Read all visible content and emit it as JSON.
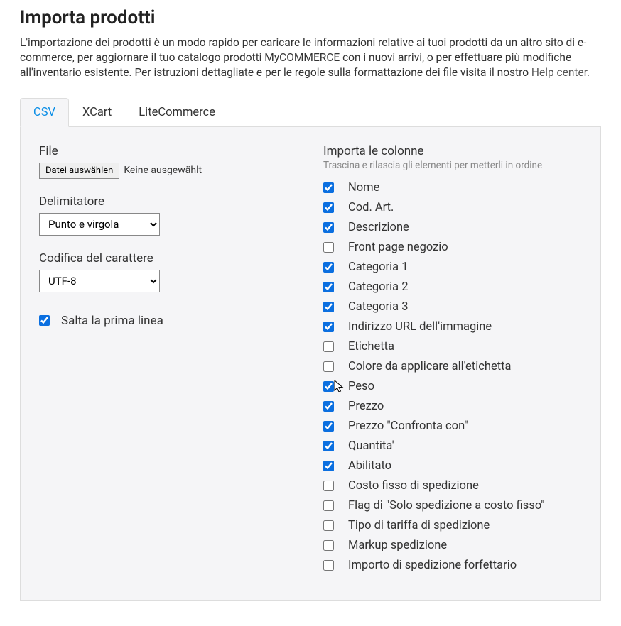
{
  "header": {
    "title": "Importa prodotti",
    "description": "L'importazione dei prodotti è un modo rapido per caricare le informazioni relative ai tuoi prodotti da un altro sito di e-commerce, per aggiornare il tuo catalogo prodotti MyCOMMERCE con i nuovi arrivi, o per effettuare più modifiche all'inventario esistente. Per istruzioni dettagliate e per le regole sulla formattazione dei file visita il nostro ",
    "help_link": "Help center."
  },
  "tabs": {
    "csv": "CSV",
    "xcart": "XCart",
    "litecommerce": "LiteCommerce"
  },
  "left": {
    "file_label": "File",
    "file_button": "Datei auswählen",
    "file_status": "Keine ausgewählt",
    "delimiter_label": "Delimitatore",
    "delimiter_value": "Punto e virgola",
    "encoding_label": "Codifica del carattere",
    "encoding_value": "UTF-8",
    "skip_first_line": "Salta la prima linea"
  },
  "right": {
    "title": "Importa le colonne",
    "hint": "Trascina e rilascia gli elementi per metterli in ordine",
    "items": [
      {
        "label": "Nome",
        "checked": true
      },
      {
        "label": "Cod. Art.",
        "checked": true
      },
      {
        "label": "Descrizione",
        "checked": true
      },
      {
        "label": "Front page negozio",
        "checked": false
      },
      {
        "label": "Categoria 1",
        "checked": true
      },
      {
        "label": "Categoria 2",
        "checked": true
      },
      {
        "label": "Categoria 3",
        "checked": true
      },
      {
        "label": "Indirizzo URL dell'immagine",
        "checked": true
      },
      {
        "label": "Etichetta",
        "checked": false
      },
      {
        "label": "Colore da applicare all'etichetta",
        "checked": false
      },
      {
        "label": "Peso",
        "checked": true
      },
      {
        "label": "Prezzo",
        "checked": true
      },
      {
        "label": "Prezzo \"Confronta con\"",
        "checked": true
      },
      {
        "label": "Quantita'",
        "checked": true
      },
      {
        "label": "Abilitato",
        "checked": true
      },
      {
        "label": "Costo fisso di spedizione",
        "checked": false
      },
      {
        "label": "Flag di \"Solo spedizione a costo fisso\"",
        "checked": false
      },
      {
        "label": "Tipo di tariffa di spedizione",
        "checked": false
      },
      {
        "label": "Markup spedizione",
        "checked": false
      },
      {
        "label": "Importo di spedizione forfettario",
        "checked": false
      }
    ]
  }
}
